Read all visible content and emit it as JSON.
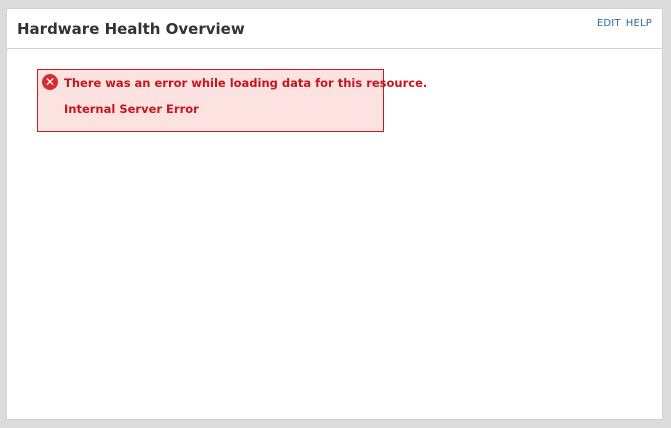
{
  "panel": {
    "title": "Hardware Health Overview",
    "edit_label": "EDIT",
    "help_label": "HELP"
  },
  "error": {
    "icon": "error-x-icon",
    "message": "There was an error while loading data for this resource.",
    "detail": "Internal Server Error",
    "colors": {
      "text": "#c4161c",
      "background": "#fde2e2",
      "border": "#c31c1c"
    }
  }
}
